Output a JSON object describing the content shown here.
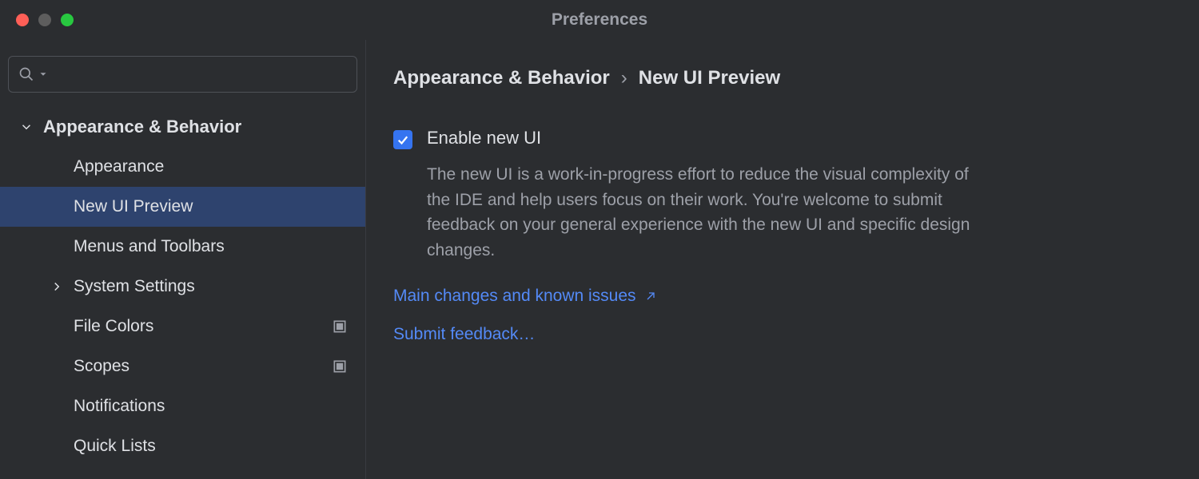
{
  "window": {
    "title": "Preferences"
  },
  "search": {
    "placeholder": ""
  },
  "sidebar": {
    "category_label": "Appearance & Behavior",
    "items": [
      {
        "label": "Appearance"
      },
      {
        "label": "New UI Preview"
      },
      {
        "label": "Menus and Toolbars"
      },
      {
        "label": "System Settings"
      },
      {
        "label": "File Colors"
      },
      {
        "label": "Scopes"
      },
      {
        "label": "Notifications"
      },
      {
        "label": "Quick Lists"
      }
    ]
  },
  "content": {
    "breadcrumb_parent": "Appearance & Behavior",
    "breadcrumb_current": "New UI Preview",
    "checkbox_label": "Enable new UI",
    "description": "The new UI is a work-in-progress effort to reduce the visual complexity of the IDE and help users focus on their work. You're welcome to submit feedback on your general experience with the new UI and specific design changes.",
    "link_changes": "Main changes and known issues",
    "link_feedback": "Submit feedback…"
  }
}
